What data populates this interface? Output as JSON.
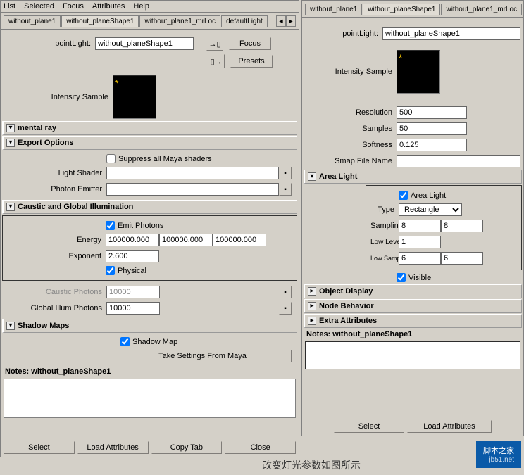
{
  "menubar": [
    "List",
    "Selected",
    "Focus",
    "Attributes",
    "Help"
  ],
  "left": {
    "tabs": [
      "without_plane1",
      "without_planeShape1",
      "without_plane1_mrLoc",
      "defaultLight"
    ],
    "active_tab": 1,
    "point_light_label": "pointLight:",
    "point_light_value": "without_planeShape1",
    "focus_btn": "Focus",
    "presets_btn": "Presets",
    "intensity_label": "Intensity Sample",
    "sections": {
      "mental_ray": "mental ray",
      "export_options": "Export Options",
      "caustic": "Caustic and Global Illumination",
      "shadow_maps": "Shadow Maps"
    },
    "suppress_label": "Suppress all Maya shaders",
    "light_shader_label": "Light Shader",
    "photon_emitter_label": "Photon Emitter",
    "emit_photons_label": "Emit Photons",
    "energy_label": "Energy",
    "energy": [
      "100000.000",
      "100000.000",
      "100000.000"
    ],
    "exponent_label": "Exponent",
    "exponent": "2.600",
    "physical_label": "Physical",
    "caustic_photons_label": "Caustic Photons",
    "caustic_photons": "10000",
    "global_illum_label": "Global Illum Photons",
    "global_illum": "10000",
    "shadow_map_label": "Shadow Map",
    "take_settings_label": "Take Settings From Maya",
    "notes_label": "Notes: without_planeShape1",
    "footer": [
      "Select",
      "Load Attributes",
      "Copy Tab",
      "Close"
    ]
  },
  "right": {
    "tabs": [
      "without_plane1",
      "without_planeShape1",
      "without_plane1_mrLoc"
    ],
    "active_tab": 1,
    "point_light_label": "pointLight:",
    "point_light_value": "without_planeShape1",
    "intensity_label": "Intensity Sample",
    "resolution_label": "Resolution",
    "resolution": "500",
    "samples_label": "Samples",
    "samples": "50",
    "softness_label": "Softness",
    "softness": "0.125",
    "smap_label": "Smap File Name",
    "smap": "",
    "area_light_section": "Area Light",
    "area_light_chk": "Area Light",
    "type_label": "Type",
    "type_value": "Rectangle",
    "sampling_label": "Sampling",
    "sampling": [
      "8",
      "8"
    ],
    "low_level_label": "Low Level",
    "low_level": "1",
    "low_sampling_label": "Low Sampling",
    "low_sampling": [
      "6",
      "6"
    ],
    "visible_label": "Visible",
    "object_display": "Object Display",
    "node_behavior": "Node Behavior",
    "extra_attributes": "Extra Attributes",
    "notes_label": "Notes: without_planeShape1",
    "footer": [
      "Select",
      "Load Attributes"
    ]
  },
  "annotation": "改变灯光参数如图所示",
  "watermark": {
    "main": "脚本之家",
    "sub": "jb51.net"
  }
}
